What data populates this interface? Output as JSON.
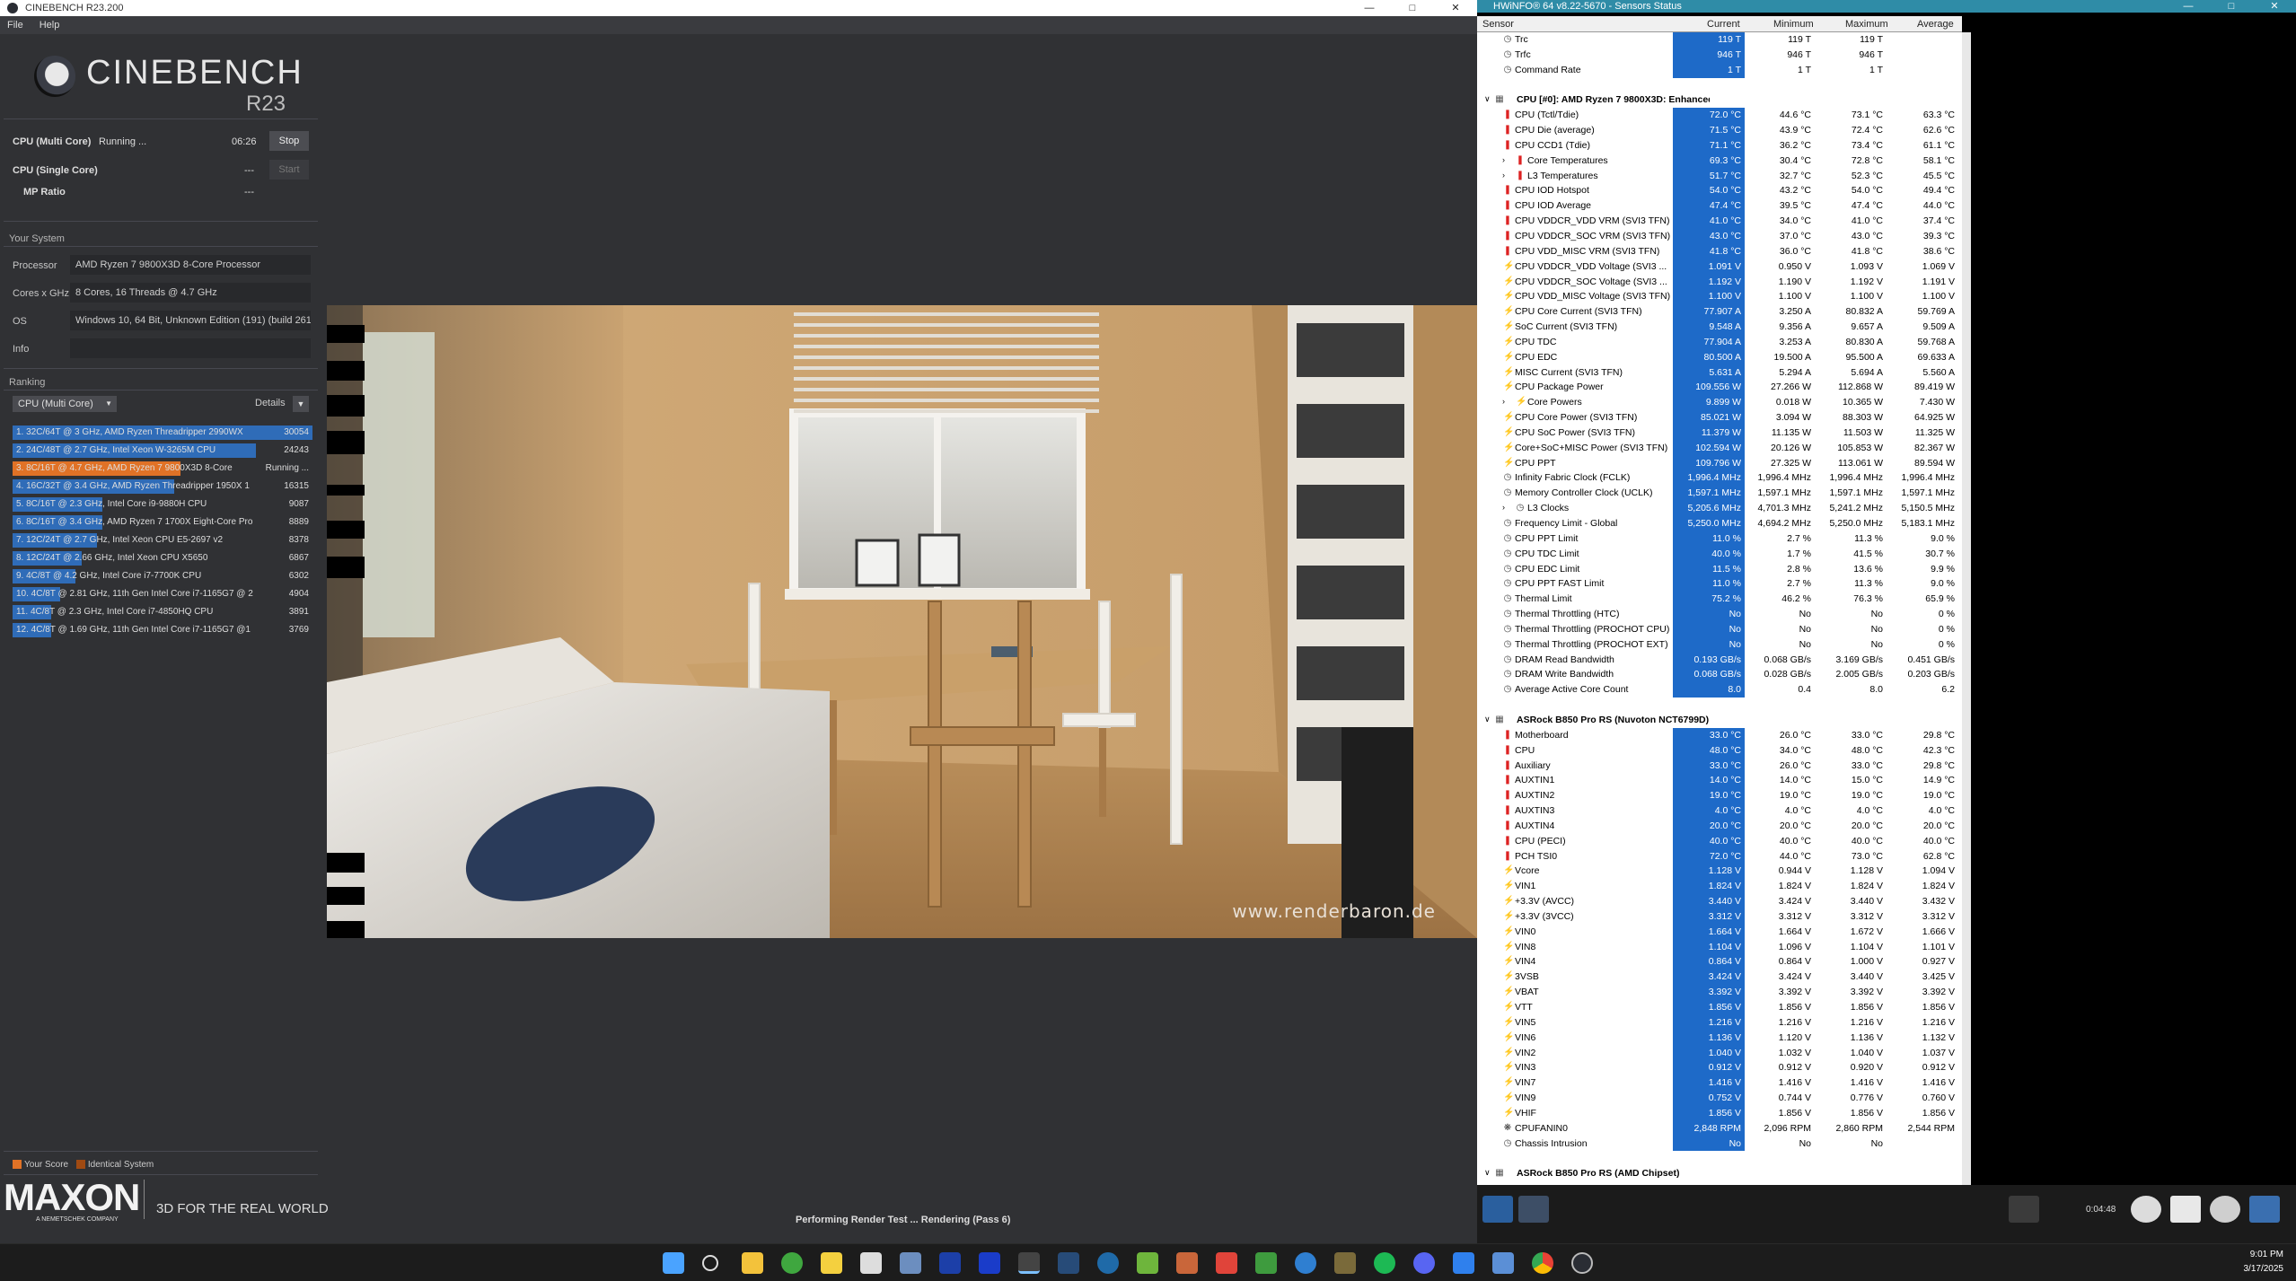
{
  "cinebench": {
    "title": "CINEBENCH R23.200",
    "menu": [
      "File",
      "Help"
    ],
    "logo_main": "CINEBENCH",
    "logo_ver": "R23",
    "multi_label": "CPU (Multi Core)",
    "multi_status": "Running ...",
    "multi_time": "06:26",
    "stop_label": "Stop",
    "single_label": "CPU (Single Core)",
    "single_value": "---",
    "start_label": "Start",
    "mp_label": "MP Ratio",
    "mp_value": "---",
    "your_system": "Your System",
    "system": [
      {
        "label": "Processor",
        "value": "AMD Ryzen 7 9800X3D 8-Core Processor"
      },
      {
        "label": "Cores x GHz",
        "value": "8 Cores, 16 Threads @ 4.7 GHz"
      },
      {
        "label": "OS",
        "value": "Windows 10, 64 Bit, Unknown Edition (191) (build 261"
      },
      {
        "label": "Info",
        "value": ""
      }
    ],
    "ranking": "Ranking",
    "ranking_select": "CPU (Multi Core)",
    "details": "Details",
    "ranks": [
      {
        "label": "1. 32C/64T @ 3 GHz, AMD Ryzen Threadripper 2990WX",
        "score": "30054",
        "frac": 1.0,
        "color": "#2f6cb8"
      },
      {
        "label": "2. 24C/48T @ 2.7 GHz, Intel Xeon W-3265M CPU",
        "score": "24243",
        "frac": 0.81,
        "color": "#2f6cb8"
      },
      {
        "label": "3. 8C/16T @ 4.7 GHz, AMD Ryzen 7 9800X3D 8-Core",
        "score": "Running ...",
        "frac": 0.56,
        "color": "#e07226"
      },
      {
        "label": "4. 16C/32T @ 3.4 GHz, AMD Ryzen Threadripper 1950X 1",
        "score": "16315",
        "frac": 0.54,
        "color": "#2f6cb8"
      },
      {
        "label": "5. 8C/16T @ 2.3 GHz, Intel Core i9-9880H CPU",
        "score": "9087",
        "frac": 0.3,
        "color": "#2f6cb8"
      },
      {
        "label": "6. 8C/16T @ 3.4 GHz, AMD Ryzen 7 1700X Eight-Core Pro",
        "score": "8889",
        "frac": 0.3,
        "color": "#2f6cb8"
      },
      {
        "label": "7. 12C/24T @ 2.7 GHz, Intel Xeon CPU E5-2697 v2",
        "score": "8378",
        "frac": 0.28,
        "color": "#2f6cb8"
      },
      {
        "label": "8. 12C/24T @ 2.66 GHz, Intel Xeon CPU X5650",
        "score": "6867",
        "frac": 0.23,
        "color": "#2f6cb8"
      },
      {
        "label": "9. 4C/8T @ 4.2 GHz, Intel Core i7-7700K CPU",
        "score": "6302",
        "frac": 0.21,
        "color": "#2f6cb8"
      },
      {
        "label": "10. 4C/8T @ 2.81 GHz, 11th Gen Intel Core i7-1165G7 @ 2",
        "score": "4904",
        "frac": 0.16,
        "color": "#2f6cb8"
      },
      {
        "label": "11. 4C/8T @ 2.3 GHz, Intel Core i7-4850HQ CPU",
        "score": "3891",
        "frac": 0.13,
        "color": "#2f6cb8"
      },
      {
        "label": "12. 4C/8T @ 1.69 GHz, 11th Gen Intel Core i7-1165G7 @1",
        "score": "3769",
        "frac": 0.13,
        "color": "#2f6cb8"
      }
    ],
    "legend_your": "Your Score",
    "legend_identical": "Identical System",
    "maxon": "MAXON",
    "maxon_sub": "A NEMETSCHEK COMPANY",
    "tagline": "3D FOR THE REAL WORLD",
    "status": "Performing Render Test ... Rendering (Pass 6)",
    "watermark": "www.renderbaron.de"
  },
  "hwinfo": {
    "title": "HWiNFO® 64 v8.22-5670 - Sensors Status",
    "columns": [
      "Sensor",
      "Current",
      "Minimum",
      "Maximum",
      "Average"
    ],
    "rows": [
      {
        "t": "s",
        "i": "clock",
        "n": "Trc",
        "v": [
          "119 T",
          "119 T",
          "119 T",
          ""
        ]
      },
      {
        "t": "s",
        "i": "clock",
        "n": "Trfc",
        "v": [
          "946 T",
          "946 T",
          "946 T",
          ""
        ]
      },
      {
        "t": "s",
        "i": "clock",
        "n": "Command Rate",
        "v": [
          "1 T",
          "1 T",
          "1 T",
          ""
        ]
      },
      {
        "t": "b"
      },
      {
        "t": "c",
        "n": "CPU [#0]: AMD Ryzen 7 9800X3D: Enhanced"
      },
      {
        "t": "s",
        "i": "temp",
        "n": "CPU (Tctl/Tdie)",
        "v": [
          "72.0 °C",
          "44.6 °C",
          "73.1 °C",
          "63.3 °C"
        ]
      },
      {
        "t": "s",
        "i": "temp",
        "n": "CPU Die (average)",
        "v": [
          "71.5 °C",
          "43.9 °C",
          "72.4 °C",
          "62.6 °C"
        ]
      },
      {
        "t": "s",
        "i": "temp",
        "n": "CPU CCD1 (Tdie)",
        "v": [
          "71.1 °C",
          "36.2 °C",
          "73.4 °C",
          "61.1 °C"
        ]
      },
      {
        "t": "x",
        "i": "temp",
        "n": "Core Temperatures",
        "v": [
          "69.3 °C",
          "30.4 °C",
          "72.8 °C",
          "58.1 °C"
        ]
      },
      {
        "t": "x",
        "i": "temp",
        "n": "L3 Temperatures",
        "v": [
          "51.7 °C",
          "32.7 °C",
          "52.3 °C",
          "45.5 °C"
        ]
      },
      {
        "t": "s",
        "i": "temp",
        "n": "CPU IOD Hotspot",
        "v": [
          "54.0 °C",
          "43.2 °C",
          "54.0 °C",
          "49.4 °C"
        ]
      },
      {
        "t": "s",
        "i": "temp",
        "n": "CPU IOD Average",
        "v": [
          "47.4 °C",
          "39.5 °C",
          "47.4 °C",
          "44.0 °C"
        ]
      },
      {
        "t": "s",
        "i": "temp",
        "n": "CPU VDDCR_VDD VRM (SVI3 TFN)",
        "v": [
          "41.0 °C",
          "34.0 °C",
          "41.0 °C",
          "37.4 °C"
        ]
      },
      {
        "t": "s",
        "i": "temp",
        "n": "CPU VDDCR_SOC VRM (SVI3 TFN)",
        "v": [
          "43.0 °C",
          "37.0 °C",
          "43.0 °C",
          "39.3 °C"
        ]
      },
      {
        "t": "s",
        "i": "temp",
        "n": "CPU VDD_MISC VRM (SVI3 TFN)",
        "v": [
          "41.8 °C",
          "36.0 °C",
          "41.8 °C",
          "38.6 °C"
        ]
      },
      {
        "t": "s",
        "i": "volt",
        "n": "CPU VDDCR_VDD Voltage (SVI3 ...",
        "v": [
          "1.091 V",
          "0.950 V",
          "1.093 V",
          "1.069 V"
        ]
      },
      {
        "t": "s",
        "i": "volt",
        "n": "CPU VDDCR_SOC Voltage (SVI3 ...",
        "v": [
          "1.192 V",
          "1.190 V",
          "1.192 V",
          "1.191 V"
        ]
      },
      {
        "t": "s",
        "i": "volt",
        "n": "CPU VDD_MISC Voltage (SVI3 TFN)",
        "v": [
          "1.100 V",
          "1.100 V",
          "1.100 V",
          "1.100 V"
        ]
      },
      {
        "t": "s",
        "i": "volt",
        "n": "CPU Core Current (SVI3 TFN)",
        "v": [
          "77.907 A",
          "3.250 A",
          "80.832 A",
          "59.769 A"
        ]
      },
      {
        "t": "s",
        "i": "volt",
        "n": "SoC Current (SVI3 TFN)",
        "v": [
          "9.548 A",
          "9.356 A",
          "9.657 A",
          "9.509 A"
        ]
      },
      {
        "t": "s",
        "i": "volt",
        "n": "CPU TDC",
        "v": [
          "77.904 A",
          "3.253 A",
          "80.830 A",
          "59.768 A"
        ]
      },
      {
        "t": "s",
        "i": "volt",
        "n": "CPU EDC",
        "v": [
          "80.500 A",
          "19.500 A",
          "95.500 A",
          "69.633 A"
        ]
      },
      {
        "t": "s",
        "i": "volt",
        "n": "MISC Current (SVI3 TFN)",
        "v": [
          "5.631 A",
          "5.294 A",
          "5.694 A",
          "5.560 A"
        ]
      },
      {
        "t": "s",
        "i": "volt",
        "n": "CPU Package Power",
        "v": [
          "109.556 W",
          "27.266 W",
          "112.868 W",
          "89.419 W"
        ]
      },
      {
        "t": "x",
        "i": "volt",
        "n": "Core Powers",
        "v": [
          "9.899 W",
          "0.018 W",
          "10.365 W",
          "7.430 W"
        ]
      },
      {
        "t": "s",
        "i": "volt",
        "n": "CPU Core Power (SVI3 TFN)",
        "v": [
          "85.021 W",
          "3.094 W",
          "88.303 W",
          "64.925 W"
        ]
      },
      {
        "t": "s",
        "i": "volt",
        "n": "CPU SoC Power (SVI3 TFN)",
        "v": [
          "11.379 W",
          "11.135 W",
          "11.503 W",
          "11.325 W"
        ]
      },
      {
        "t": "s",
        "i": "volt",
        "n": "Core+SoC+MISC Power (SVI3 TFN)",
        "v": [
          "102.594 W",
          "20.126 W",
          "105.853 W",
          "82.367 W"
        ]
      },
      {
        "t": "s",
        "i": "volt",
        "n": "CPU PPT",
        "v": [
          "109.796 W",
          "27.325 W",
          "113.061 W",
          "89.594 W"
        ]
      },
      {
        "t": "s",
        "i": "clock",
        "n": "Infinity Fabric Clock (FCLK)",
        "v": [
          "1,996.4 MHz",
          "1,996.4 MHz",
          "1,996.4 MHz",
          "1,996.4 MHz"
        ]
      },
      {
        "t": "s",
        "i": "clock",
        "n": "Memory Controller Clock (UCLK)",
        "v": [
          "1,597.1 MHz",
          "1,597.1 MHz",
          "1,597.1 MHz",
          "1,597.1 MHz"
        ]
      },
      {
        "t": "x",
        "i": "clock",
        "n": "L3 Clocks",
        "v": [
          "5,205.6 MHz",
          "4,701.3 MHz",
          "5,241.2 MHz",
          "5,150.5 MHz"
        ]
      },
      {
        "t": "s",
        "i": "clock",
        "n": "Frequency Limit - Global",
        "v": [
          "5,250.0 MHz",
          "4,694.2 MHz",
          "5,250.0 MHz",
          "5,183.1 MHz"
        ]
      },
      {
        "t": "s",
        "i": "clock",
        "n": "CPU PPT Limit",
        "v": [
          "11.0 %",
          "2.7 %",
          "11.3 %",
          "9.0 %"
        ]
      },
      {
        "t": "s",
        "i": "clock",
        "n": "CPU TDC Limit",
        "v": [
          "40.0 %",
          "1.7 %",
          "41.5 %",
          "30.7 %"
        ]
      },
      {
        "t": "s",
        "i": "clock",
        "n": "CPU EDC Limit",
        "v": [
          "11.5 %",
          "2.8 %",
          "13.6 %",
          "9.9 %"
        ]
      },
      {
        "t": "s",
        "i": "clock",
        "n": "CPU PPT FAST Limit",
        "v": [
          "11.0 %",
          "2.7 %",
          "11.3 %",
          "9.0 %"
        ]
      },
      {
        "t": "s",
        "i": "clock",
        "n": "Thermal Limit",
        "v": [
          "75.2 %",
          "46.2 %",
          "76.3 %",
          "65.9 %"
        ]
      },
      {
        "t": "s",
        "i": "clock",
        "n": "Thermal Throttling (HTC)",
        "v": [
          "No",
          "No",
          "No",
          "0 %"
        ]
      },
      {
        "t": "s",
        "i": "clock",
        "n": "Thermal Throttling (PROCHOT CPU)",
        "v": [
          "No",
          "No",
          "No",
          "0 %"
        ]
      },
      {
        "t": "s",
        "i": "clock",
        "n": "Thermal Throttling (PROCHOT EXT)",
        "v": [
          "No",
          "No",
          "No",
          "0 %"
        ]
      },
      {
        "t": "s",
        "i": "clock",
        "n": "DRAM Read Bandwidth",
        "v": [
          "0.193 GB/s",
          "0.068 GB/s",
          "3.169 GB/s",
          "0.451 GB/s"
        ]
      },
      {
        "t": "s",
        "i": "clock",
        "n": "DRAM Write Bandwidth",
        "v": [
          "0.068 GB/s",
          "0.028 GB/s",
          "2.005 GB/s",
          "0.203 GB/s"
        ]
      },
      {
        "t": "s",
        "i": "clock",
        "n": "Average Active Core Count",
        "v": [
          "8.0",
          "0.4",
          "8.0",
          "6.2"
        ]
      },
      {
        "t": "b"
      },
      {
        "t": "c",
        "n": "ASRock B850 Pro RS (Nuvoton NCT6799D)"
      },
      {
        "t": "s",
        "i": "temp",
        "n": "Motherboard",
        "v": [
          "33.0 °C",
          "26.0 °C",
          "33.0 °C",
          "29.8 °C"
        ]
      },
      {
        "t": "s",
        "i": "temp",
        "n": "CPU",
        "v": [
          "48.0 °C",
          "34.0 °C",
          "48.0 °C",
          "42.3 °C"
        ]
      },
      {
        "t": "s",
        "i": "temp",
        "n": "Auxiliary",
        "v": [
          "33.0 °C",
          "26.0 °C",
          "33.0 °C",
          "29.8 °C"
        ]
      },
      {
        "t": "s",
        "i": "temp",
        "n": "AUXTIN1",
        "v": [
          "14.0 °C",
          "14.0 °C",
          "15.0 °C",
          "14.9 °C"
        ]
      },
      {
        "t": "s",
        "i": "temp",
        "n": "AUXTIN2",
        "v": [
          "19.0 °C",
          "19.0 °C",
          "19.0 °C",
          "19.0 °C"
        ]
      },
      {
        "t": "s",
        "i": "temp",
        "n": "AUXTIN3",
        "v": [
          "4.0 °C",
          "4.0 °C",
          "4.0 °C",
          "4.0 °C"
        ]
      },
      {
        "t": "s",
        "i": "temp",
        "n": "AUXTIN4",
        "v": [
          "20.0 °C",
          "20.0 °C",
          "20.0 °C",
          "20.0 °C"
        ]
      },
      {
        "t": "s",
        "i": "temp",
        "n": "CPU (PECI)",
        "v": [
          "40.0 °C",
          "40.0 °C",
          "40.0 °C",
          "40.0 °C"
        ]
      },
      {
        "t": "s",
        "i": "temp",
        "n": "PCH TSI0",
        "v": [
          "72.0 °C",
          "44.0 °C",
          "73.0 °C",
          "62.8 °C"
        ]
      },
      {
        "t": "s",
        "i": "volt",
        "n": "Vcore",
        "v": [
          "1.128 V",
          "0.944 V",
          "1.128 V",
          "1.094 V"
        ]
      },
      {
        "t": "s",
        "i": "volt",
        "n": "VIN1",
        "v": [
          "1.824 V",
          "1.824 V",
          "1.824 V",
          "1.824 V"
        ]
      },
      {
        "t": "s",
        "i": "volt",
        "n": "+3.3V (AVCC)",
        "v": [
          "3.440 V",
          "3.424 V",
          "3.440 V",
          "3.432 V"
        ]
      },
      {
        "t": "s",
        "i": "volt",
        "n": "+3.3V (3VCC)",
        "v": [
          "3.312 V",
          "3.312 V",
          "3.312 V",
          "3.312 V"
        ]
      },
      {
        "t": "s",
        "i": "volt",
        "n": "VIN0",
        "v": [
          "1.664 V",
          "1.664 V",
          "1.672 V",
          "1.666 V"
        ]
      },
      {
        "t": "s",
        "i": "volt",
        "n": "VIN8",
        "v": [
          "1.104 V",
          "1.096 V",
          "1.104 V",
          "1.101 V"
        ]
      },
      {
        "t": "s",
        "i": "volt",
        "n": "VIN4",
        "v": [
          "0.864 V",
          "0.864 V",
          "1.000 V",
          "0.927 V"
        ]
      },
      {
        "t": "s",
        "i": "volt",
        "n": "3VSB",
        "v": [
          "3.424 V",
          "3.424 V",
          "3.440 V",
          "3.425 V"
        ]
      },
      {
        "t": "s",
        "i": "volt",
        "n": "VBAT",
        "v": [
          "3.392 V",
          "3.392 V",
          "3.392 V",
          "3.392 V"
        ]
      },
      {
        "t": "s",
        "i": "volt",
        "n": "VTT",
        "v": [
          "1.856 V",
          "1.856 V",
          "1.856 V",
          "1.856 V"
        ]
      },
      {
        "t": "s",
        "i": "volt",
        "n": "VIN5",
        "v": [
          "1.216 V",
          "1.216 V",
          "1.216 V",
          "1.216 V"
        ]
      },
      {
        "t": "s",
        "i": "volt",
        "n": "VIN6",
        "v": [
          "1.136 V",
          "1.120 V",
          "1.136 V",
          "1.132 V"
        ]
      },
      {
        "t": "s",
        "i": "volt",
        "n": "VIN2",
        "v": [
          "1.040 V",
          "1.032 V",
          "1.040 V",
          "1.037 V"
        ]
      },
      {
        "t": "s",
        "i": "volt",
        "n": "VIN3",
        "v": [
          "0.912 V",
          "0.912 V",
          "0.920 V",
          "0.912 V"
        ]
      },
      {
        "t": "s",
        "i": "volt",
        "n": "VIN7",
        "v": [
          "1.416 V",
          "1.416 V",
          "1.416 V",
          "1.416 V"
        ]
      },
      {
        "t": "s",
        "i": "volt",
        "n": "VIN9",
        "v": [
          "0.752 V",
          "0.744 V",
          "0.776 V",
          "0.760 V"
        ]
      },
      {
        "t": "s",
        "i": "volt",
        "n": "VHIF",
        "v": [
          "1.856 V",
          "1.856 V",
          "1.856 V",
          "1.856 V"
        ]
      },
      {
        "t": "s",
        "i": "fan",
        "n": "CPUFANIN0",
        "v": [
          "2,848 RPM",
          "2,096 RPM",
          "2,860 RPM",
          "2,544 RPM"
        ]
      },
      {
        "t": "s",
        "i": "clock",
        "n": "Chassis Intrusion",
        "v": [
          "No",
          "No",
          "No",
          ""
        ]
      },
      {
        "t": "b"
      },
      {
        "t": "c",
        "n": "ASRock B850 Pro RS (AMD Chipset)"
      }
    ],
    "timer": "0:04:48"
  },
  "taskbar": {
    "time": "9:01 PM",
    "date": "3/17/2025"
  }
}
